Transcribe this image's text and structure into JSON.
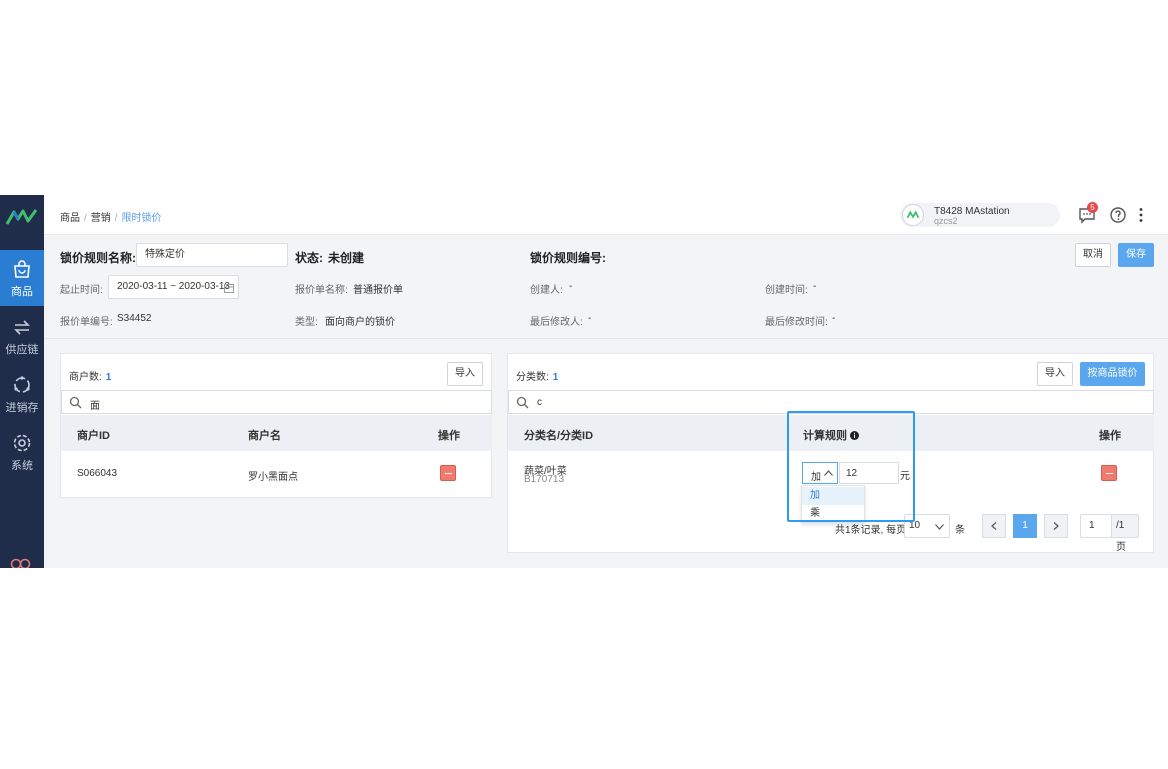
{
  "sidebar": {
    "items": [
      {
        "label": "商品",
        "icon": "shopping-bag-icon"
      },
      {
        "label": "供应链",
        "icon": "exchange-icon"
      },
      {
        "label": "进销存",
        "icon": "cycle-icon"
      },
      {
        "label": "系统",
        "icon": "gear-icon"
      }
    ]
  },
  "header": {
    "breadcrumb": [
      "商品",
      "营销",
      "限时锁价"
    ],
    "user": {
      "name": "T8428 MAstation",
      "sub": "qzcs2"
    },
    "notification_count": "5"
  },
  "form": {
    "rule_name_label": "锁价规则名称:",
    "rule_name_value": "特殊定价",
    "status_label": "状态:",
    "status_value": "未创建",
    "rule_no_label": "锁价规则编号:",
    "start_time_label": "起止时间:",
    "start_time_value": "2020-03-11 ~ 2020-03-13",
    "quote_name_label": "报价单名称:",
    "quote_name_value": "普通报价单",
    "creator_label": "创建人:",
    "creator_value": "-",
    "created_time_label": "创建时间:",
    "created_time_value": "-",
    "quote_no_label": "报价单编号:",
    "quote_no_value": "S34452",
    "type_label": "类型:",
    "type_value": "面向商户的锁价",
    "modifier_label": "最后修改人:",
    "modifier_value": "-",
    "modified_time_label": "最后修改时间:",
    "modified_time_value": "-",
    "cancel_label": "取消",
    "save_label": "保存"
  },
  "merchants": {
    "count_label": "商户数:",
    "count": "1",
    "import_label": "导入",
    "search_value": "面",
    "columns": [
      "商户ID",
      "商户名",
      "操作"
    ],
    "rows": [
      {
        "id": "S066043",
        "name": "罗小黑面点"
      }
    ]
  },
  "categories": {
    "count_label": "分类数:",
    "count": "1",
    "import_label": "导入",
    "lock_by_goods_label": "按商品锁价",
    "search_value": "c",
    "columns": [
      "分类名/分类ID",
      "计算规则",
      "操作"
    ],
    "rows": [
      {
        "name": "蔬菜/叶菜",
        "id": "B170713",
        "rule": "加",
        "amount": "12",
        "unit": "元"
      }
    ],
    "rule_options": [
      "加",
      "乘"
    ],
    "pagination": {
      "summary": "共1条记录, 每页",
      "page_size": "10",
      "page_size_unit": "条",
      "current_page": "1",
      "goto_page": "1",
      "total_pages": "/1页"
    }
  }
}
